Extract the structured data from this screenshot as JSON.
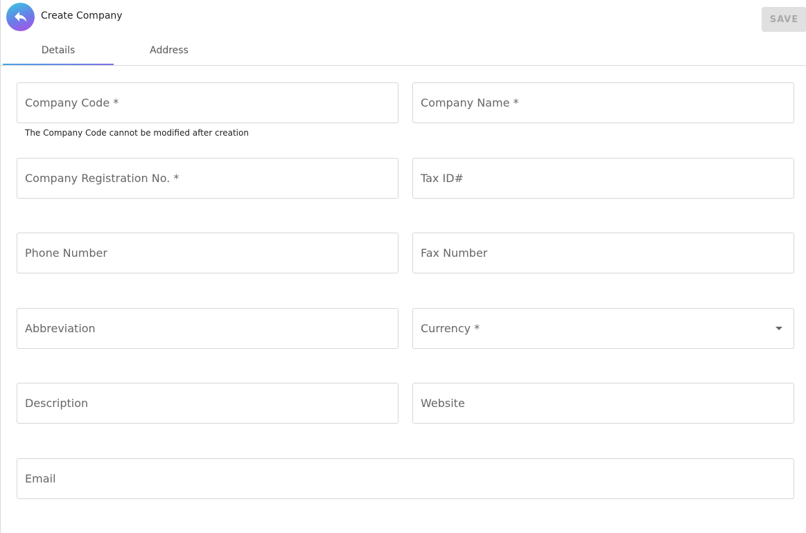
{
  "header": {
    "title": "Create Company",
    "back_icon": "reply-arrow-icon",
    "save_label": "SAVE"
  },
  "tabs": [
    {
      "label": "Details",
      "active": true
    },
    {
      "label": "Address",
      "active": false
    }
  ],
  "form": {
    "company_code": {
      "placeholder": "Company Code *",
      "helper": "The Company Code cannot be modified after creation"
    },
    "company_name": {
      "placeholder": "Company Name *"
    },
    "registration_no": {
      "placeholder": "Company Registration No. *"
    },
    "tax_id": {
      "placeholder": "Tax ID#"
    },
    "phone": {
      "placeholder": "Phone Number"
    },
    "fax": {
      "placeholder": "Fax Number"
    },
    "abbreviation": {
      "placeholder": "Abbreviation"
    },
    "currency": {
      "placeholder": "Currency *",
      "icon": "caret-down-icon"
    },
    "description": {
      "placeholder": "Description"
    },
    "website": {
      "placeholder": "Website"
    },
    "email": {
      "placeholder": "Email"
    }
  },
  "colors": {
    "accent_start": "#4aa3e8",
    "accent_end": "#7b6fe6",
    "back_gradient": [
      "#35c9e0",
      "#6b7ce8",
      "#b14ee6"
    ],
    "save_disabled_bg": "#e0e0e0",
    "save_disabled_text": "#a8a8a8"
  }
}
